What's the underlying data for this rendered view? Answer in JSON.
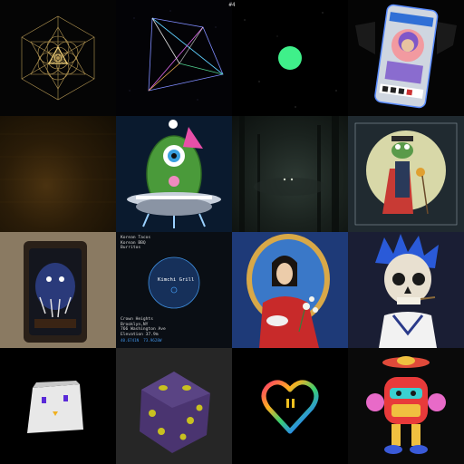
{
  "header": {
    "counter": "#4"
  },
  "gallery": {
    "tiles": [
      {
        "icon": "sacred-geometry"
      },
      {
        "icon": "wireframe-polyhedron"
      },
      {
        "icon": "green-dot"
      },
      {
        "icon": "soda-can-portrait"
      },
      {
        "icon": "amber-gradient"
      },
      {
        "icon": "ufo-monster"
      },
      {
        "icon": "dark-forest"
      },
      {
        "icon": "frog-wizard-card"
      },
      {
        "icon": "framed-creature"
      },
      {
        "icon": "neighborhood-map"
      },
      {
        "icon": "madonna-painting"
      },
      {
        "icon": "blue-hair-skull"
      },
      {
        "icon": "white-cube-face"
      },
      {
        "icon": "purple-dice"
      },
      {
        "icon": "rainbow-heart"
      },
      {
        "icon": "red-robot"
      }
    ]
  },
  "map_card": {
    "menu": [
      "Korean Tacos",
      "Korean BBQ",
      "Burritos"
    ],
    "place_label": "Kimchi Grill",
    "address": [
      "Crown Heights",
      "Brooklyn,NY",
      "766 Washington Ave",
      "Elevation 37.9m"
    ],
    "coordinates": "40.6741N  73.9628W"
  },
  "colors": {
    "background": "#000000",
    "green_dot": "#3ff08a",
    "map_blue": "#3f8fe0"
  }
}
